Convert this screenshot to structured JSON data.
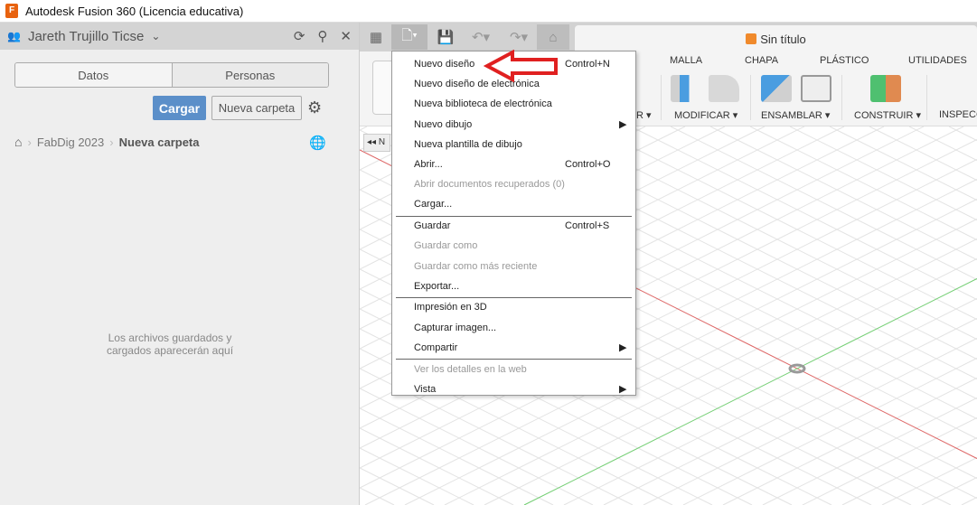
{
  "window": {
    "title": "Autodesk Fusion 360 (Licencia educativa)",
    "icon_letter": "F"
  },
  "data_panel": {
    "user": "Jareth Trujillo Ticse",
    "tabs": [
      "Datos",
      "Personas"
    ],
    "upload_label": "Cargar",
    "new_folder_label": "Nueva carpeta",
    "breadcrumb": [
      "FabDig 2023",
      "Nueva carpeta"
    ],
    "empty_text": [
      "Los archivos guardados y",
      "cargados aparecerán aquí"
    ]
  },
  "document": {
    "title": "Sin título"
  },
  "ribbon": {
    "tabs": [
      "MALLA",
      "CHAPA",
      "PLÁSTICO",
      "UTILIDADES"
    ],
    "groups": [
      "R ▾",
      "MODIFICAR ▾",
      "ENSAMBLAR ▾",
      "CONSTRUIR ▾",
      "INSPECC"
    ]
  },
  "browser": {
    "collapse_label": "◂◂ N"
  },
  "file_menu": {
    "items": [
      {
        "label": "Nuevo diseño",
        "shortcut": "Control+N"
      },
      {
        "label": "Nuevo diseño de electrónica"
      },
      {
        "label": "Nueva biblioteca de electrónica"
      },
      {
        "label": "Nuevo dibujo",
        "submenu": "▶"
      },
      {
        "label": "Nueva plantilla de dibujo"
      },
      {
        "label": "Abrir...",
        "shortcut": "Control+O"
      },
      {
        "label": "Abrir documentos recuperados (0)",
        "disabled": true
      },
      {
        "label": "Cargar..."
      },
      {
        "label": "Guardar",
        "shortcut": "Control+S"
      },
      {
        "label": "Guardar como",
        "disabled": true
      },
      {
        "label": "Guardar como más reciente",
        "disabled": true
      },
      {
        "label": "Exportar..."
      },
      {
        "label": "Impresión en 3D"
      },
      {
        "label": "Capturar imagen..."
      },
      {
        "label": "Compartir",
        "submenu": "▶"
      },
      {
        "label": "Ver los detalles en la web",
        "disabled": true
      },
      {
        "label": "Vista",
        "submenu": "▶"
      }
    ]
  },
  "colors": {
    "accent": "#5b8fc9",
    "annotation_arrow": "#e02020",
    "x_axis": "#e06060",
    "y_axis": "#70d070"
  }
}
